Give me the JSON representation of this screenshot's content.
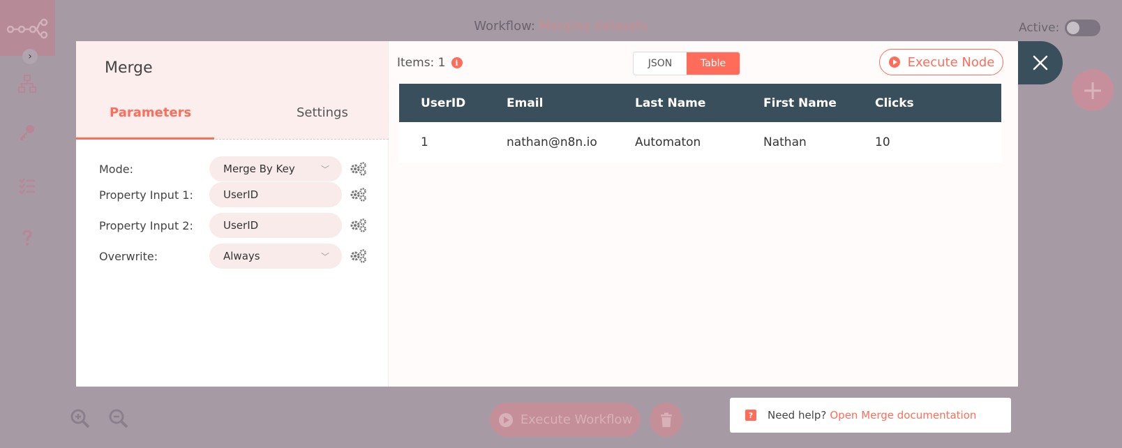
{
  "app": {
    "workflow_prefix": "Workflow:",
    "workflow_name": "Merging datasets",
    "active_label": "Active:",
    "execute_workflow_label": "Execute Workflow"
  },
  "node": {
    "title": "Merge",
    "tabs": {
      "parameters": "Parameters",
      "settings": "Settings"
    },
    "params": [
      {
        "label": "Mode:",
        "value": "Merge By Key",
        "type": "select"
      },
      {
        "label": "Property Input 1:",
        "value": "UserID",
        "type": "text"
      },
      {
        "label": "Property Input 2:",
        "value": "UserID",
        "type": "text"
      },
      {
        "label": "Overwrite:",
        "value": "Always",
        "type": "select"
      }
    ]
  },
  "output": {
    "items_label": "Items: 1",
    "view_json": "JSON",
    "view_table": "Table",
    "execute_node_label": "Execute Node",
    "columns": [
      "UserID",
      "Email",
      "Last Name",
      "First Name",
      "Clicks"
    ],
    "rows": [
      [
        "1",
        "nathan@n8n.io",
        "Automaton",
        "Nathan",
        "10"
      ]
    ]
  },
  "help": {
    "prefix": "Need help?",
    "link": "Open Merge documentation"
  },
  "colors": {
    "accent": "#ff6d5a",
    "header_dark": "#3a4f5c"
  }
}
